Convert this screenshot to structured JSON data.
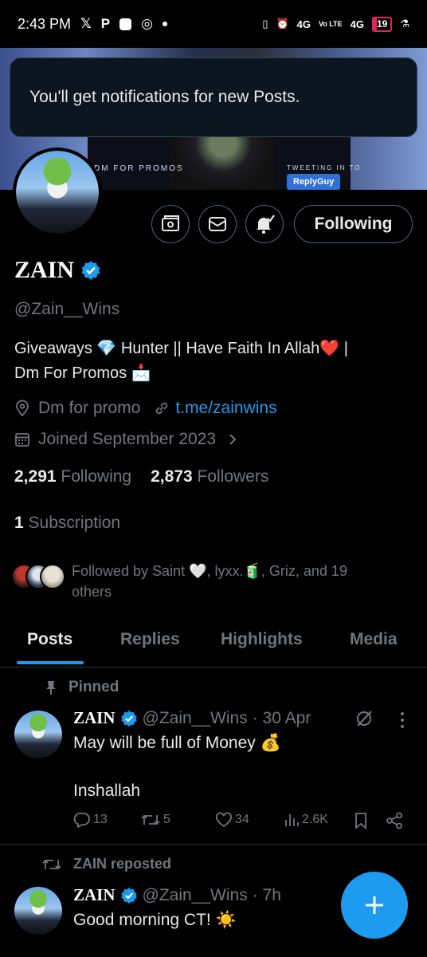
{
  "status_bar": {
    "time": "2:43 PM",
    "network_1": "4G",
    "network_2": "Vo LTE",
    "network_3": "4G",
    "battery": "19",
    "battery_level": 0.19
  },
  "banner": {
    "dm_text": "DM FOR PROMOS",
    "tweeting_text": "TWEETING IN TO",
    "replyguy_label": "ReplyGuy"
  },
  "toast": {
    "message": "You'll get notifications for new Posts."
  },
  "profile": {
    "following_button": "Following",
    "name": "ZAIN",
    "handle": "@Zain__Wins",
    "bio_line1": "Giveaways 💎 Hunter || Have Faith In Allah❤️ |",
    "bio_line2": "Dm For Promos 📩",
    "location": "Dm for promo",
    "website": "t.me/zainwins",
    "joined": "Joined September 2023",
    "following_count": "2,291",
    "following_label": "Following",
    "followers_count": "2,873",
    "followers_label": "Followers",
    "subscription_count": "1",
    "subscription_label": "Subscription",
    "followed_by_line1": "Followed by Saint 🤍, lyxx.🧃, Griz, and 19",
    "followed_by_line2": "others"
  },
  "tabs": [
    {
      "label": "Posts"
    },
    {
      "label": "Replies"
    },
    {
      "label": "Highlights"
    },
    {
      "label": "Media"
    }
  ],
  "posts": [
    {
      "context": "Pinned",
      "name": "ZAIN",
      "handle": "@Zain__Wins",
      "time": "· 30 Apr",
      "text_line1": "May will be full of Money 💰",
      "text_line2": "Inshallah",
      "replies": "13",
      "reposts": "5",
      "likes": "34",
      "views": "2.6K"
    },
    {
      "context": "ZAIN reposted",
      "name": "ZAIN",
      "handle": "@Zain__Wins",
      "time": "· 7h",
      "text_line1": "Good morning CT! ☀️"
    }
  ],
  "fab": {
    "icon": "plus-icon"
  },
  "colors": {
    "accent": "#1d9bf0",
    "background": "#000000",
    "muted": "#71767b",
    "text": "#e7e9ea"
  }
}
